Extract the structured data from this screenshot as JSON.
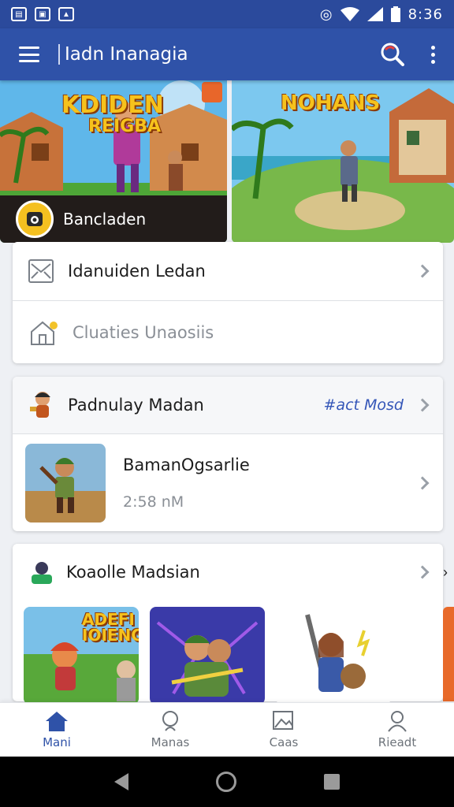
{
  "status_bar": {
    "time": "8:36"
  },
  "app_bar": {
    "title": "Iadn Inanagia"
  },
  "banners": [
    {
      "headline": "KDIDEN",
      "subline": "REIGBA",
      "caption": "Bancladen"
    },
    {
      "headline": "NOHANS"
    }
  ],
  "menu_card": {
    "items": [
      {
        "label": "Idanuiden Ledan"
      },
      {
        "label": "Cluaties Unaosiis"
      }
    ]
  },
  "featured_card": {
    "header": "Padnulay Madan",
    "action_link": "#act Mosd",
    "item": {
      "title": "BamanOgsarlie",
      "time": "2:58 nM"
    }
  },
  "collection_card": {
    "header": "Koaolle Madsian",
    "tile1_text": "ADEFI IOIENG"
  },
  "bottom_nav": {
    "items": [
      {
        "label": "Mani",
        "icon": "home-icon"
      },
      {
        "label": "Manas",
        "icon": "search-person-icon"
      },
      {
        "label": "Caas",
        "icon": "gallery-icon"
      },
      {
        "label": "Rieadt",
        "icon": "profile-icon"
      }
    ]
  },
  "colors": {
    "primary": "#2f52a8",
    "status": "#2b4a9c",
    "accent_link": "#3456b8"
  }
}
